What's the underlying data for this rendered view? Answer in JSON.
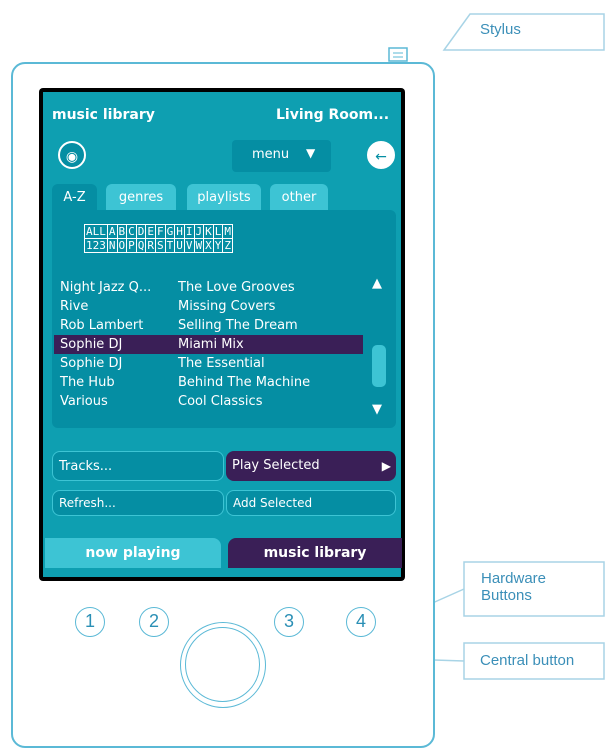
{
  "callouts": {
    "stylus": "Stylus",
    "hardware_line1": "Hardware",
    "hardware_line2": "Buttons",
    "central": "Central button"
  },
  "screen": {
    "header_left": "music library",
    "header_right": "Living Room...",
    "menu_label": "menu",
    "tabs": [
      "A-Z",
      "genres",
      "playlists",
      "other"
    ],
    "alpha_row1": [
      "ALL",
      "A",
      "B",
      "C",
      "D",
      "E",
      "F",
      "G",
      "H",
      "I",
      "J",
      "K",
      "L",
      "M"
    ],
    "alpha_row2": [
      "123",
      "N",
      "O",
      "P",
      "Q",
      "R",
      "S",
      "T",
      "U",
      "V",
      "W",
      "X",
      "Y",
      "Z"
    ],
    "rows": [
      {
        "artist": "Night Jazz Q...",
        "album": "The Love Grooves"
      },
      {
        "artist": "Rive",
        "album": "Missing Covers"
      },
      {
        "artist": "Rob Lambert",
        "album": "Selling The Dream"
      },
      {
        "artist": "Sophie DJ",
        "album": "Miami Mix"
      },
      {
        "artist": "Sophie DJ",
        "album": "The Essential"
      },
      {
        "artist": "The Hub",
        "album": "Behind The Machine"
      },
      {
        "artist": "Various",
        "album": "Cool Classics"
      }
    ],
    "tracks_btn": "Tracks...",
    "play_selected_btn": "Play Selected",
    "refresh_btn": "Refresh...",
    "add_selected_btn": "Add Selected",
    "now_playing_tab": "now playing",
    "music_library_tab": "music library"
  },
  "hardware_buttons": [
    "1",
    "2",
    "3",
    "4"
  ],
  "colors": {
    "teal": "#0e9fb1",
    "dark_teal": "#058ea3",
    "light_teal": "#3dc4d4",
    "purple": "#3a1f57",
    "outline": "#5bb9d6"
  }
}
